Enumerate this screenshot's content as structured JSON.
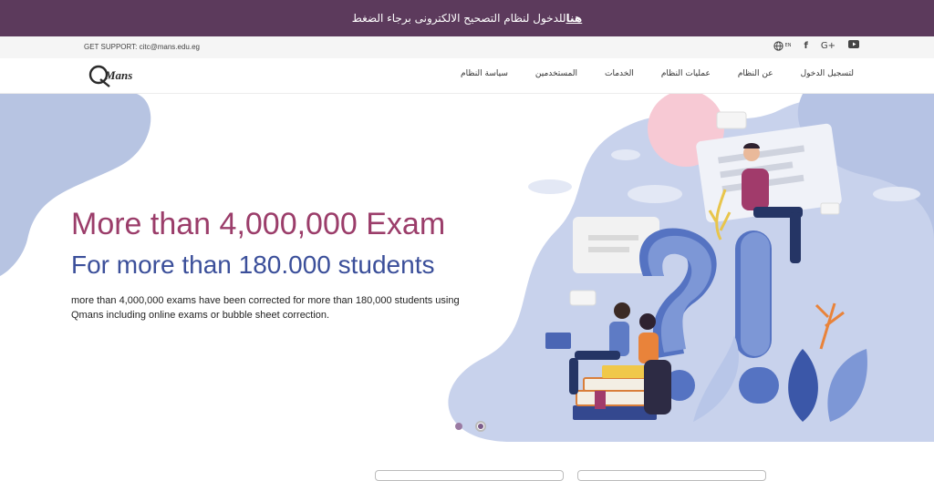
{
  "announcement": {
    "text": "للدخول لنظام التصحيح الالكترونى برجاء الضغط ",
    "link": "هنا"
  },
  "support": {
    "text": "GET SUPPORT: citc@mans.edu.eg"
  },
  "social": {
    "lang": "EN",
    "facebook": "f",
    "google": "G+",
    "youtube": "▶"
  },
  "logo": {
    "text": "Mans"
  },
  "menu": [
    "لتسجيل الدخول",
    "عن النظام",
    "عمليات النظام",
    "الخدمات",
    "المستخدمين",
    "سياسة النظام"
  ],
  "hero": {
    "headline": "More than 4,000,000 Exam",
    "subheadline": "For more than 180.000 students",
    "description": "more than 4,000,000 exams have been corrected for more than 180,000 students using Qmans including online exams or bubble sheet correction."
  },
  "colors": {
    "brand": "#5c3a5c",
    "headline": "#9b3d6a",
    "subheadline": "#3b4f9a"
  }
}
